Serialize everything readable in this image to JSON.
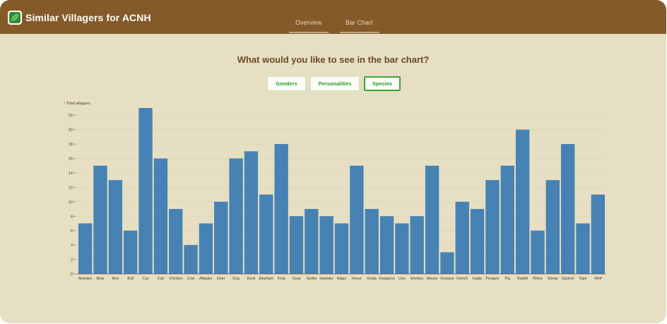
{
  "app": {
    "title": "Similar Villagers for ACNH"
  },
  "nav": {
    "tabs": [
      {
        "label": "Overview"
      },
      {
        "label": "Bar Chart"
      }
    ]
  },
  "main": {
    "question": "What would you like to see in the bar chart?",
    "options": [
      {
        "label": "Genders"
      },
      {
        "label": "Personalities"
      },
      {
        "label": "Species",
        "selected": true
      }
    ]
  },
  "colors": {
    "header": "#845a29",
    "background": "#e6dfc3",
    "bar": "#4682b4",
    "accent": "#2f9a2f"
  },
  "chart_data": {
    "type": "bar",
    "title": "",
    "xlabel": "",
    "ylabel": "↑ Total villagers",
    "ylim": [
      0,
      23
    ],
    "yticks": [
      0,
      2,
      4,
      6,
      8,
      10,
      12,
      14,
      16,
      18,
      20,
      22
    ],
    "grid": true,
    "categories": [
      "Anteater",
      "Bear",
      "Bird",
      "Bull",
      "Cat",
      "Cub",
      "Chicken",
      "Cow",
      "Alligator",
      "Deer",
      "Dog",
      "Duck",
      "Elephant",
      "Frog",
      "Goat",
      "Gorilla",
      "Hamster",
      "Hippo",
      "Horse",
      "Koala",
      "Kangaroo",
      "Lion",
      "Monkey",
      "Mouse",
      "Octopus",
      "Ostrich",
      "Eagle",
      "Penguin",
      "Pig",
      "Rabbit",
      "Rhino",
      "Sheep",
      "Squirrel",
      "Tiger",
      "Wolf"
    ],
    "values": [
      7,
      15,
      13,
      6,
      23,
      16,
      9,
      4,
      7,
      10,
      16,
      17,
      11,
      18,
      8,
      9,
      8,
      7,
      15,
      9,
      8,
      7,
      8,
      15,
      3,
      10,
      9,
      13,
      15,
      20,
      6,
      13,
      18,
      7,
      11
    ]
  }
}
